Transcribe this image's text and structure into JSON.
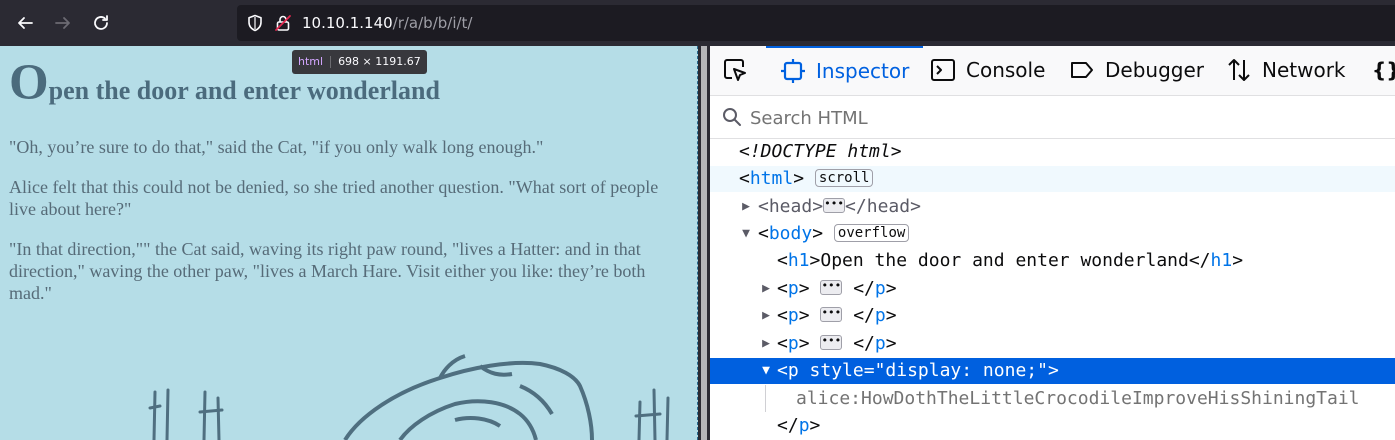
{
  "browser": {
    "url_host": "10.10.1.140",
    "url_path": "/r/a/b/b/i/t/"
  },
  "page": {
    "title_first": "O",
    "title_rest": "pen the door and enter wonderland",
    "paragraphs": [
      "\"Oh, you’re sure to do that,\" said the Cat, \"if you only walk long enough.\"",
      "Alice felt that this could not be denied, so she tried another question. \"What sort of people live about here?\"",
      "\"In that direction,\"\" the Cat said, waving its right paw round, \"lives a Hatter: and in that direction,\" waving the other paw, \"lives a March Hare. Visit either you like: they’re both mad.\""
    ]
  },
  "tooltip": {
    "tag": "html",
    "size": "698 × 1191.67"
  },
  "devtools": {
    "tabs": [
      "Inspector",
      "Console",
      "Debugger",
      "Network",
      "{}"
    ],
    "active_tab": "Inspector",
    "search_placeholder": "Search HTML",
    "tree": {
      "doctype": "<!DOCTYPE html>",
      "html_tag": "html",
      "html_badge": "scroll",
      "head_tag": "head",
      "body_tag": "body",
      "body_badge": "overflow",
      "h1_tag": "h1",
      "h1_text": "Open the door and enter wonderland",
      "p_tag": "p",
      "p_attr_name": "style",
      "p_attr_value": "\"display: none;\"",
      "hidden_text": "alice:HowDothTheLittleCrocodileImproveHisShiningTail",
      "ellipsis": "•••"
    }
  },
  "colors": {
    "page_bg": "#b5dde7",
    "heading": "#4b6b7d",
    "body_text": "#566b78",
    "devtools_accent": "#0061e0",
    "selection": "#0060df"
  }
}
